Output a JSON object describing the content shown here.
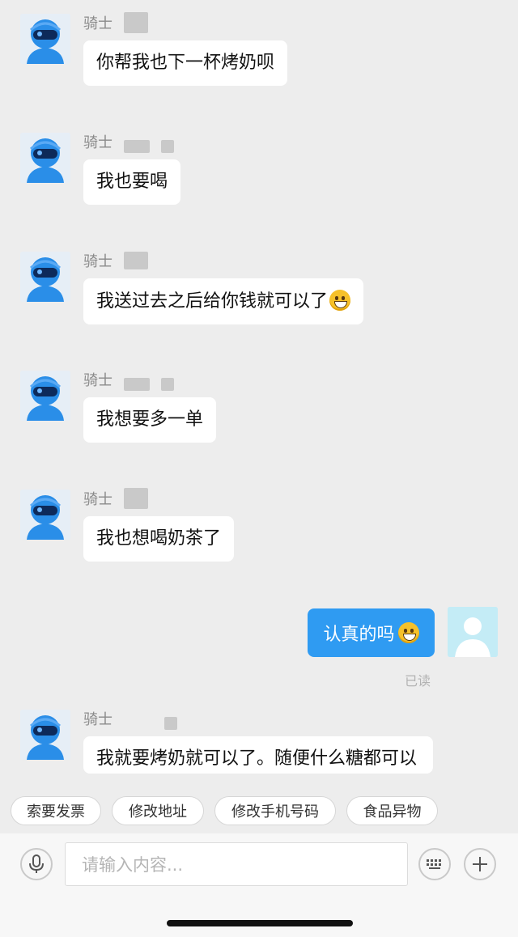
{
  "messages": [
    {
      "sender": "骑士",
      "text": "你帮我也下一杯烤奶呗"
    },
    {
      "sender": "骑士",
      "text": "我也要喝"
    },
    {
      "sender": "骑士",
      "text": "我送过去之后给你钱就可以了"
    },
    {
      "sender": "骑士",
      "text": "我想要多一单"
    },
    {
      "sender": "骑士",
      "text": "我也想喝奶茶了"
    },
    {
      "sender": "骑士",
      "text": "我就要烤奶就可以了。随便什么糖都可以"
    }
  ],
  "outgoing": {
    "text": "认真的吗",
    "status": "已读"
  },
  "quick_replies": [
    "索要发票",
    "修改地址",
    "修改手机号码",
    "食品异物"
  ],
  "input": {
    "placeholder": "请输入内容..."
  },
  "icons": {
    "emoji_grin": "grinning-emoji",
    "emoji_laugh": "tears-of-joy-emoji",
    "mic": "microphone-icon",
    "keyboard": "keyboard-icon",
    "plus": "plus-icon"
  },
  "colors": {
    "outgoing_bubble": "#2f9bf2",
    "background": "#ededed"
  }
}
